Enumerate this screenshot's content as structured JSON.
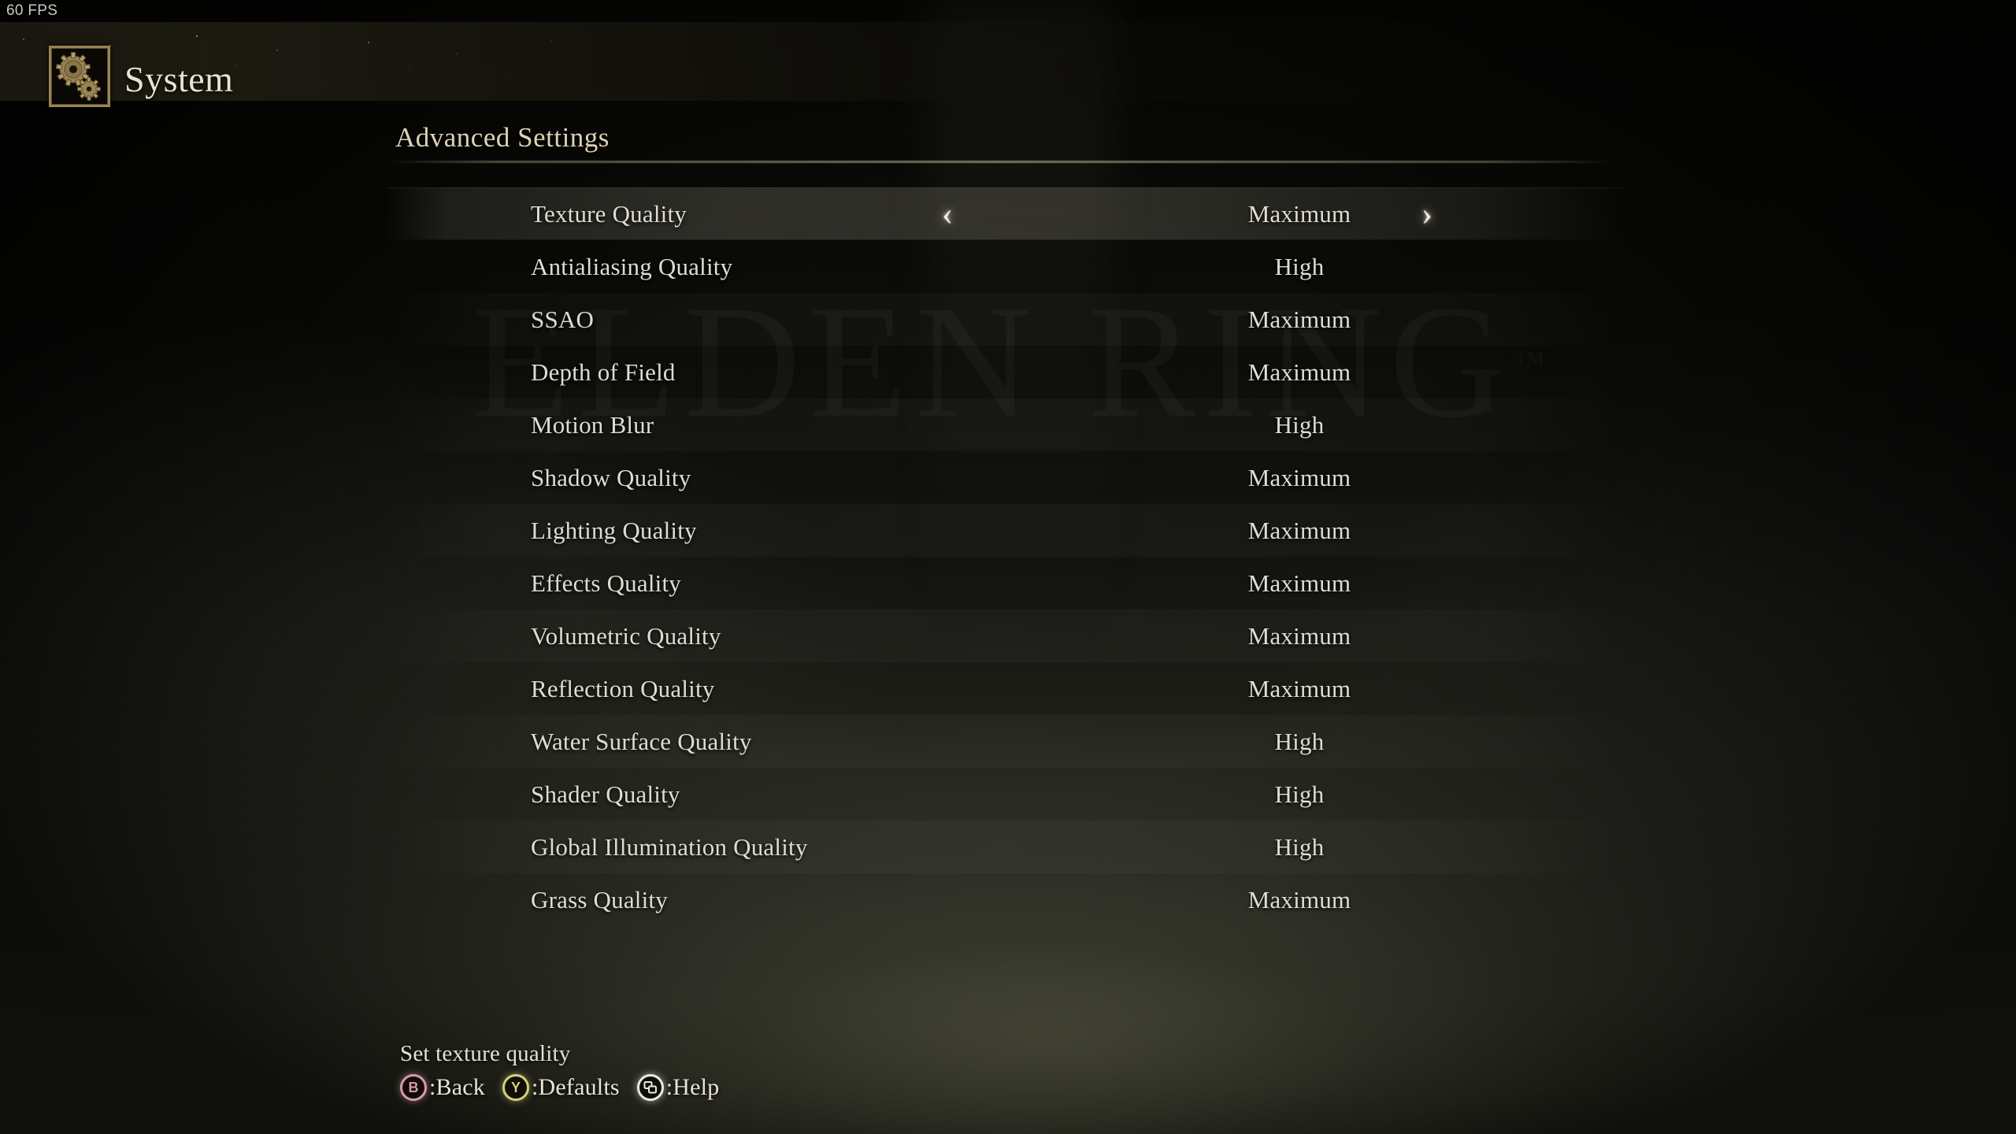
{
  "overlay": {
    "fps_counter": "60 FPS"
  },
  "header": {
    "icon": "gears-icon",
    "title": "System"
  },
  "section": {
    "title": "Advanced Settings"
  },
  "watermark": {
    "text": "ELDEN RING",
    "trademark": "™"
  },
  "settings": {
    "selected_index": 0,
    "left_arrow": "‹",
    "right_arrow": "›",
    "rows": [
      {
        "label": "Texture Quality",
        "value": "Maximum"
      },
      {
        "label": "Antialiasing Quality",
        "value": "High"
      },
      {
        "label": "SSAO",
        "value": "Maximum"
      },
      {
        "label": "Depth of Field",
        "value": "Maximum"
      },
      {
        "label": "Motion Blur",
        "value": "High"
      },
      {
        "label": "Shadow Quality",
        "value": "Maximum"
      },
      {
        "label": "Lighting Quality",
        "value": "Maximum"
      },
      {
        "label": "Effects Quality",
        "value": "Maximum"
      },
      {
        "label": "Volumetric Quality",
        "value": "Maximum"
      },
      {
        "label": "Reflection Quality",
        "value": "Maximum"
      },
      {
        "label": "Water Surface Quality",
        "value": "High"
      },
      {
        "label": "Shader Quality",
        "value": "High"
      },
      {
        "label": "Global Illumination Quality",
        "value": "High"
      },
      {
        "label": "Grass Quality",
        "value": "Maximum"
      }
    ]
  },
  "footer": {
    "description": "Set texture quality",
    "prompts": [
      {
        "button": "B",
        "icon": "button-b-icon",
        "label": ":Back"
      },
      {
        "button": "Y",
        "icon": "button-y-icon",
        "label": ":Defaults"
      },
      {
        "button": "",
        "icon": "help-window-icon",
        "label": ":Help"
      }
    ]
  },
  "colors": {
    "text_primary": "#dfdcd2",
    "title_gold": "#ddd2b4",
    "button_b": "#d99aa8",
    "button_y": "#d6cf7a",
    "button_help": "#eceade",
    "frame_gold": "#9a8454"
  }
}
